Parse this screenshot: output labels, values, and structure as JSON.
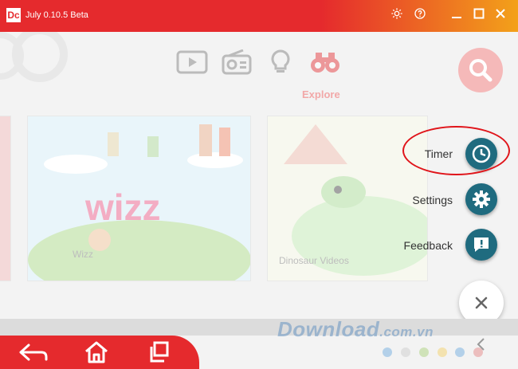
{
  "window": {
    "title": "July 0.10.5 Beta",
    "logo_text": "Dc",
    "colors": {
      "brand_red": "#e52a2d",
      "accent_orange": "#f3a11a"
    }
  },
  "navbar": {
    "items": [
      {
        "icon": "video-icon",
        "label": ""
      },
      {
        "icon": "radio-icon",
        "label": ""
      },
      {
        "icon": "lightbulb-icon",
        "label": ""
      },
      {
        "icon": "binoculars-icon",
        "label": "Explore"
      }
    ]
  },
  "cards": [
    {
      "title": "Wizz",
      "caption": "Wizz"
    },
    {
      "title": "",
      "caption": "Dinosaur Videos"
    }
  ],
  "fab_menu": {
    "items": [
      {
        "label": "Timer",
        "icon": "clock-icon"
      },
      {
        "label": "Settings",
        "icon": "gear-icon"
      },
      {
        "label": "Feedback",
        "icon": "feedback-icon"
      }
    ],
    "close_icon": "close-icon"
  },
  "watermark": {
    "text": "Download",
    "suffix": ".com.vn"
  },
  "bottom_nav": {
    "buttons": [
      "back-icon",
      "home-icon",
      "recent-apps-icon"
    ],
    "dot_colors": [
      "#3b8fd6",
      "#bdbdbd",
      "#8bc34a",
      "#f4c430",
      "#3b8fd6",
      "#e05b5b"
    ]
  }
}
